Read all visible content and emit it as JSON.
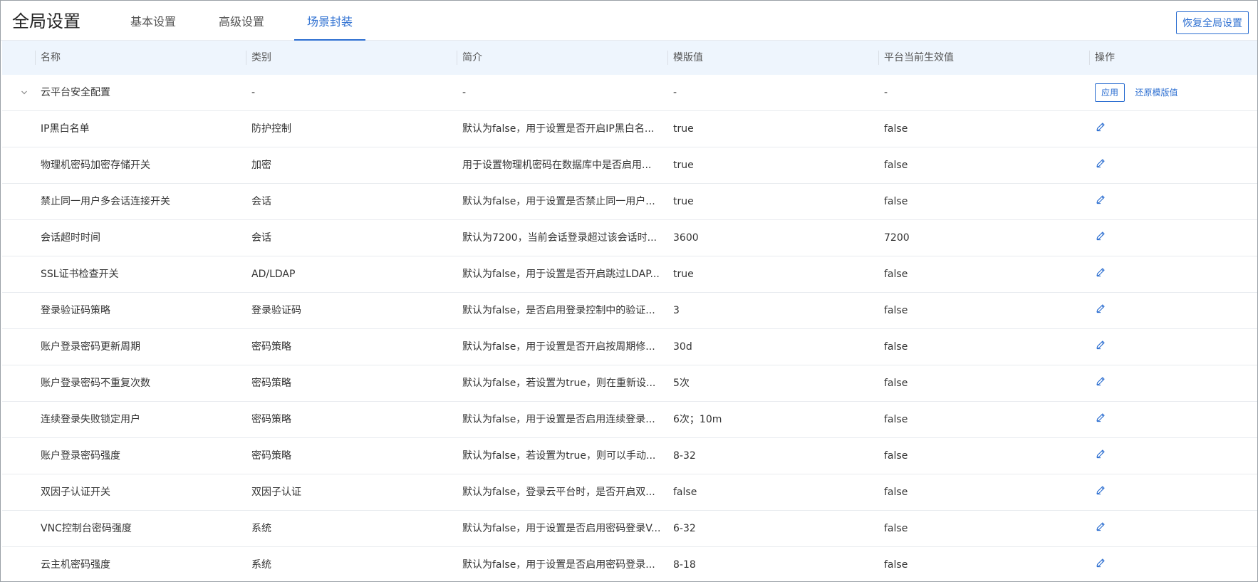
{
  "header": {
    "title": "全局设置",
    "tabs": [
      {
        "label": "基本设置",
        "active": false
      },
      {
        "label": "高级设置",
        "active": false
      },
      {
        "label": "场景封装",
        "active": true
      }
    ],
    "restore_global_label": "恢复全局设置"
  },
  "colors": {
    "accent": "#2d6fd1",
    "header_bg": "#eef5fd",
    "border": "#e8ebef"
  },
  "table": {
    "columns": [
      "名称",
      "类别",
      "简介",
      "模版值",
      "平台当前生效值",
      "操作"
    ],
    "group": {
      "name": "云平台安全配置",
      "category": "-",
      "summary": "-",
      "template_value": "-",
      "current_value": "-",
      "apply_label": "应用",
      "restore_label": "还原模版值",
      "icon": "chevron-down-icon"
    },
    "rows": [
      {
        "name": "IP黑白名单",
        "category": "防护控制",
        "summary": "默认为false，用于设置是否开启IP黑白名...",
        "template_value": "true",
        "current_value": "false"
      },
      {
        "name": "物理机密码加密存储开关",
        "category": "加密",
        "summary": "用于设置物理机密码在数据库中是否启用...",
        "template_value": "true",
        "current_value": "false"
      },
      {
        "name": "禁止同一用户多会话连接开关",
        "category": "会话",
        "summary": "默认为false，用于设置是否禁止同一用户...",
        "template_value": "true",
        "current_value": "false"
      },
      {
        "name": "会话超时时间",
        "category": "会话",
        "summary": "默认为7200，当前会话登录超过该会话时...",
        "template_value": "3600",
        "current_value": "7200"
      },
      {
        "name": "SSL证书检查开关",
        "category": "AD/LDAP",
        "summary": "默认为false，用于设置是否开启跳过LDAP...",
        "template_value": "true",
        "current_value": "false"
      },
      {
        "name": "登录验证码策略",
        "category": "登录验证码",
        "summary": "默认为false，是否启用登录控制中的验证...",
        "template_value": "3",
        "current_value": "false"
      },
      {
        "name": "账户登录密码更新周期",
        "category": "密码策略",
        "summary": "默认为false，用于设置是否开启按周期修...",
        "template_value": "30d",
        "current_value": "false"
      },
      {
        "name": "账户登录密码不重复次数",
        "category": "密码策略",
        "summary": "默认为false，若设置为true，则在重新设...",
        "template_value": "5次",
        "current_value": "false"
      },
      {
        "name": "连续登录失败锁定用户",
        "category": "密码策略",
        "summary": "默认为false，用于设置是否启用连续登录...",
        "template_value": "6次；10m",
        "current_value": "false"
      },
      {
        "name": "账户登录密码强度",
        "category": "密码策略",
        "summary": "默认为false，若设置为true，则可以手动...",
        "template_value": "8-32",
        "current_value": "false"
      },
      {
        "name": "双因子认证开关",
        "category": "双因子认证",
        "summary": "默认为false，登录云平台时，是否开启双...",
        "template_value": "false",
        "current_value": "false"
      },
      {
        "name": "VNC控制台密码强度",
        "category": "系统",
        "summary": "默认为false，用于设置是否启用密码登录V...",
        "template_value": "6-32",
        "current_value": "false"
      },
      {
        "name": "云主机密码强度",
        "category": "系统",
        "summary": "默认为false，用于设置是否启用密码登录...",
        "template_value": "8-18",
        "current_value": "false"
      }
    ],
    "row_action_icon": "edit-pencil-icon"
  }
}
